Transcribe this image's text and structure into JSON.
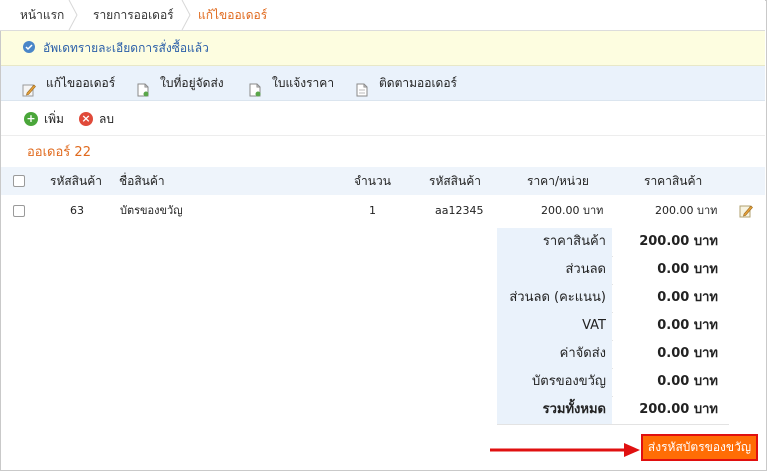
{
  "breadcrumb": {
    "home": "หน้าแรก",
    "orders": "รายการออเดอร์",
    "current": "แก้ไขออเดอร์"
  },
  "notice": {
    "text": "อัพเดทรายละเอียดการสั่งซื้อแล้ว",
    "icon": "info-icon"
  },
  "toolbar": {
    "items": [
      {
        "label": "แก้ไขออเดอร์",
        "icon": "edit-icon"
      },
      {
        "label": "ใบที่อยู่จัดส่ง",
        "icon": "document-icon"
      },
      {
        "label": "ใบแจ้งราคา",
        "icon": "document-icon"
      },
      {
        "label": "ติดตามออเดอร์",
        "icon": "document-icon"
      }
    ]
  },
  "actions": {
    "add": "เพิ่ม",
    "delete": "ลบ"
  },
  "order": {
    "title": "ออเดอร์ 22"
  },
  "table": {
    "headers": [
      "รหัสสินค้า",
      "ชื่อสินค้า",
      "จำนวน",
      "รหัสสินค้า",
      "ราคา/หน่วย",
      "ราคาสินค้า"
    ],
    "rows": [
      {
        "code": "63",
        "name": "บัตรของขวัญ",
        "qty": "1",
        "sku": "aa12345",
        "unit_price": "200.00 บาท",
        "price": "200.00 บาท"
      }
    ]
  },
  "summary": [
    {
      "label": "ราคาสินค้า",
      "value": "200.00 บาท"
    },
    {
      "label": "ส่วนลด",
      "value": "0.00 บาท"
    },
    {
      "label": "ส่วนลด (คะแนน)",
      "value": "0.00 บาท"
    },
    {
      "label": "VAT",
      "value": "0.00 บาท"
    },
    {
      "label": "ค่าจัดส่ง",
      "value": "0.00 บาท"
    },
    {
      "label": "บัตรของขวัญ",
      "value": "0.00 บาท"
    },
    {
      "label": "รวมทั้งหมด",
      "value": "200.00 บาท"
    }
  ],
  "send_button": {
    "label": "ส่งรหัสบัตรของขวัญ"
  },
  "colors": {
    "accent": "#e06a1e",
    "button_bg": "#ff6d05",
    "arrow": "#e01010",
    "info": "#2a5ea8"
  }
}
